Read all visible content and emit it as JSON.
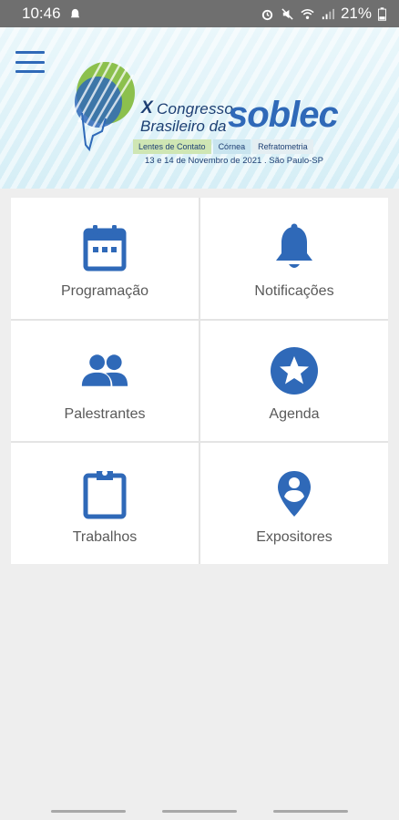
{
  "status_bar": {
    "time": "10:46",
    "battery": "21%"
  },
  "header": {
    "logo": {
      "numeral": "X",
      "line1": "Congresso",
      "line2": "Brasileiro da",
      "brand": "soblec",
      "tags": [
        "Lentes de Contato",
        "Córnea",
        "Refratometria"
      ],
      "date_place": "13 e 14 de Novembro de 2021 . São Paulo-SP"
    }
  },
  "menu": {
    "tiles": [
      {
        "label": "Programação",
        "icon": "calendar-icon"
      },
      {
        "label": "Notificações",
        "icon": "bell-icon"
      },
      {
        "label": "Palestrantes",
        "icon": "people-icon"
      },
      {
        "label": "Agenda",
        "icon": "star-icon"
      },
      {
        "label": "Trabalhos",
        "icon": "clipboard-icon"
      },
      {
        "label": "Expositores",
        "icon": "location-pin-icon"
      }
    ]
  },
  "colors": {
    "accent": "#2f69b8",
    "status_bar": "#6f6f6f",
    "background": "#eeeeee"
  }
}
